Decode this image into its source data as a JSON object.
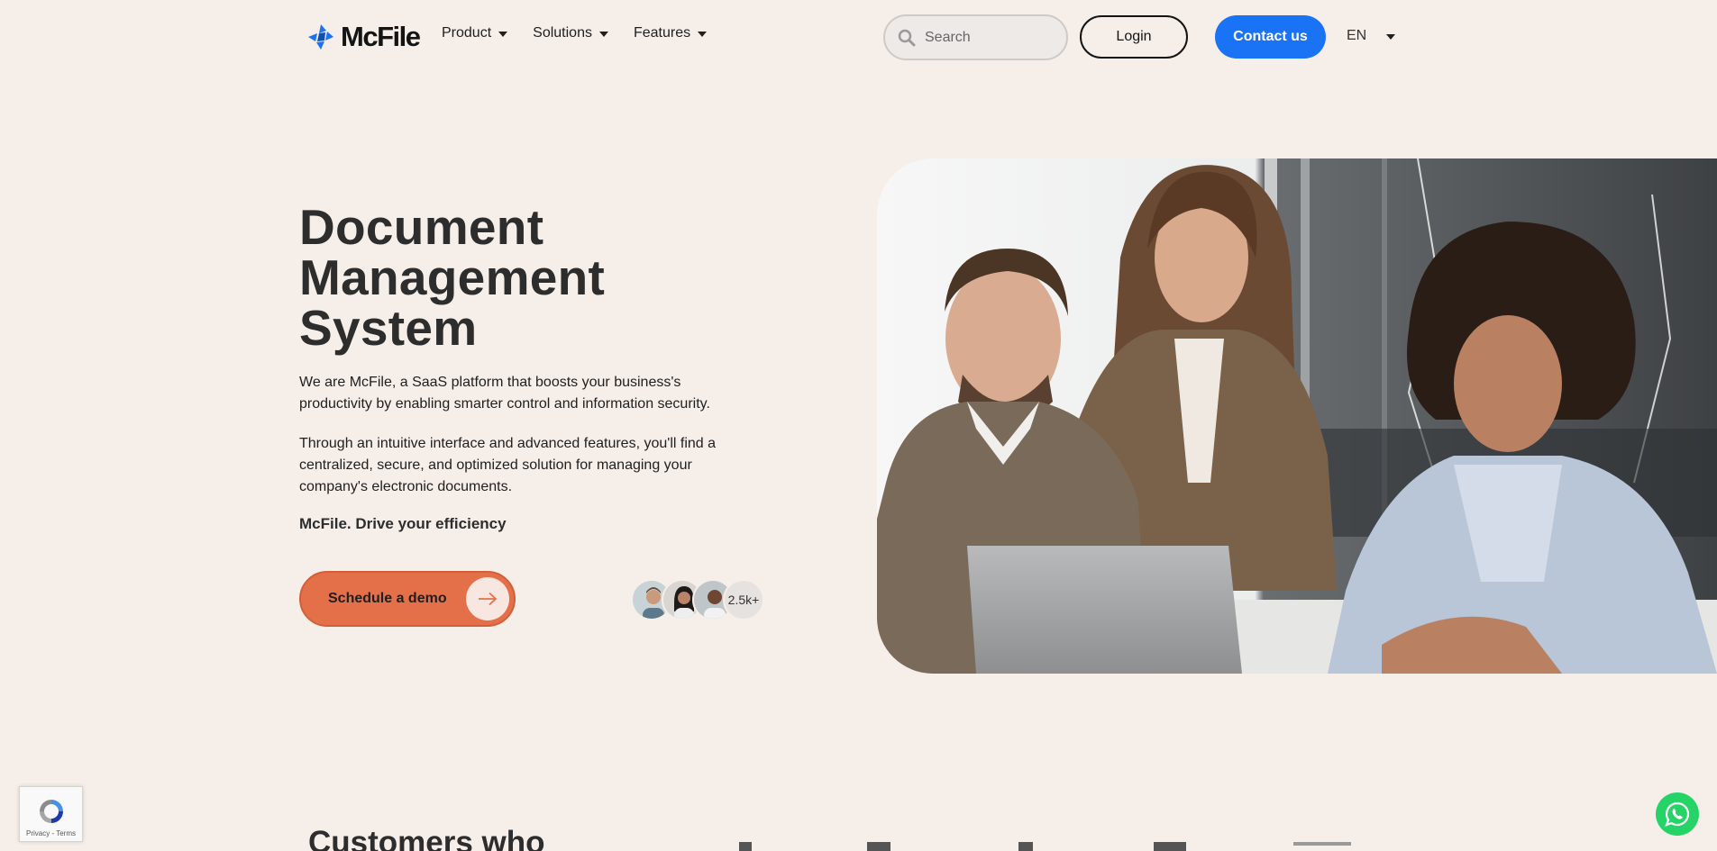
{
  "nav": {
    "logo_text": "McFile",
    "menu": [
      {
        "label": "Product"
      },
      {
        "label": "Solutions"
      },
      {
        "label": "Features"
      }
    ],
    "search_placeholder": "Search",
    "login_label": "Login",
    "contact_label": "Contact us",
    "language": "EN",
    "colors": {
      "brand_blue": "#1a73f5"
    }
  },
  "hero": {
    "title_line1": "Document",
    "title_line2": "Management",
    "title_line3": "System",
    "paragraph1": "We are McFile, a SaaS platform that boosts your business's productivity by enabling smarter control and information security.",
    "paragraph2": "Through an intuitive interface and advanced features, you'll find a centralized, secure, and optimized solution for managing your company's electronic documents.",
    "tagline": "McFile. Drive your efficiency",
    "cta_label": "Schedule a demo",
    "users_count": "2.5k+",
    "colors": {
      "cta": "#e4704a"
    }
  },
  "customers": {
    "title": "Customers who"
  },
  "widgets": {
    "recaptcha_links": "Privacy - Terms",
    "whatsapp": "whatsapp-icon"
  }
}
